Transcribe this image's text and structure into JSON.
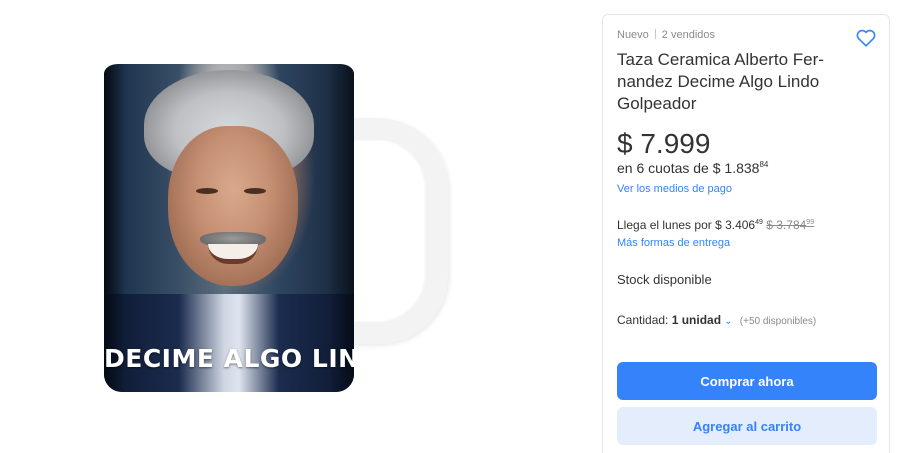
{
  "product": {
    "condition": "Nuevo",
    "sold": "2 vendidos",
    "title": "Taza Ceramica Alberto Fer-nandez Decime Algo Lindo Golpeador",
    "image_caption": "DECIME ALGO LINDO"
  },
  "pricing": {
    "price": "$ 7.999",
    "installments_prefix": "en 6 cuotas de $ 1.838",
    "installments_cents": "84",
    "payment_link": "Ver los medios de pago"
  },
  "shipping": {
    "text_prefix": "Llega el lunes por $ 3.406",
    "price_cents": "49",
    "old_price": "$ 3.784",
    "old_price_cents": "99",
    "more_link": "Más formas de entrega"
  },
  "stock": {
    "label": "Stock disponible"
  },
  "quantity": {
    "label": "Cantidad:",
    "value": "1 unidad",
    "available": "(+50 disponibles)"
  },
  "actions": {
    "buy_label": "Comprar ahora",
    "cart_label": "Agregar al carrito"
  },
  "icons": {
    "favorite": "heart-icon",
    "quantity_dropdown": "chevron-down-icon"
  },
  "colors": {
    "accent": "#3483fa",
    "secondary_button": "#e3edfb"
  }
}
